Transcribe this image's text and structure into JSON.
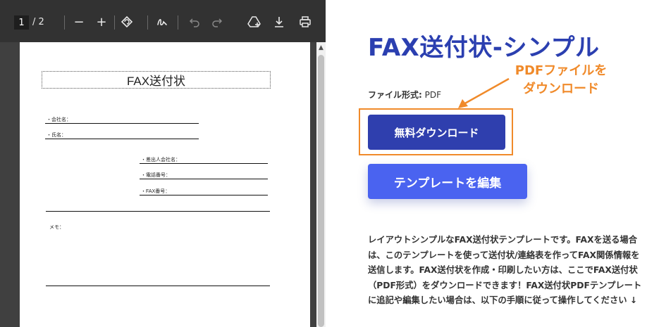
{
  "viewer": {
    "current_page": "1",
    "page_total": "/ 2",
    "zoom_out_glyph": "−",
    "zoom_in_glyph": "+"
  },
  "document": {
    "title": "FAX送付状",
    "fields": {
      "company": "・会社名：",
      "name": "・氏名：",
      "sender_company": "・差出人会社名：",
      "phone": "・電話番号：",
      "fax": "・FAX番号：",
      "memo": "メモ："
    }
  },
  "panel": {
    "title": "FAX送付状-シンプル",
    "annotation_line1": "PDFファイルを",
    "annotation_line2": "ダウンロード",
    "format_label": "ファイル形式:",
    "format_value": "PDF",
    "download_button": "無料ダウンロード",
    "edit_button": "テンプレートを編集",
    "description": "レイアウトシンプルなFAX送付状テンプレートです。FAXを送る場合は、このテンプレートを使って送付状/連絡表を作ってFAX関係情報を送信します。FAX送付状を作成・印刷したい方は、ここでFAX送付状（PDF形式）をダウンロードできます！FAX送付状PDFテンプレートに追記や編集したい場合は、以下の手順に従って操作してください ↓"
  },
  "colors": {
    "title_blue": "#2b3fb0",
    "download_button": "#2f3fae",
    "edit_button": "#4a63f0",
    "annotation_orange": "#f08a2a",
    "viewer_toolbar": "#323232"
  }
}
